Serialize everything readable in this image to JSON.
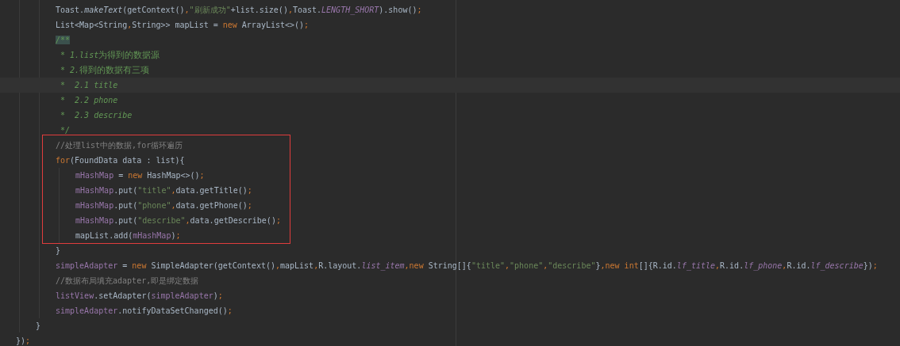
{
  "editor": {
    "code": [
      {
        "kind": "block",
        "children": [
          {
            "kind": "block",
            "children": [
              {
                "kind": "line",
                "tokens": [
                  {
                    "kind": "plain",
                    "text": "Toast."
                  },
                  {
                    "kind": "static-method",
                    "text": "makeText"
                  },
                  {
                    "kind": "plain",
                    "text": "(getContext()"
                  },
                  {
                    "kind": "punct",
                    "text": ","
                  },
                  {
                    "kind": "string",
                    "text": "\"刷新成功\""
                  },
                  {
                    "kind": "plain",
                    "text": "+list.size()"
                  },
                  {
                    "kind": "punct",
                    "text": ","
                  },
                  {
                    "kind": "plain",
                    "text": "Toast."
                  },
                  {
                    "kind": "static",
                    "text": "LENGTH_SHORT"
                  },
                  {
                    "kind": "plain",
                    "text": ").show()"
                  },
                  {
                    "kind": "punct",
                    "text": ";"
                  }
                ]
              },
              {
                "kind": "line",
                "tokens": [
                  {
                    "kind": "plain",
                    "text": "List<Map<String"
                  },
                  {
                    "kind": "punct",
                    "text": ","
                  },
                  {
                    "kind": "plain",
                    "text": "String>> mapList = "
                  },
                  {
                    "kind": "keyword",
                    "text": "new"
                  },
                  {
                    "kind": "plain",
                    "text": " ArrayList<>()"
                  },
                  {
                    "kind": "punct",
                    "text": ";"
                  }
                ]
              },
              {
                "kind": "line",
                "tokens": [
                  {
                    "kind": "doc-match",
                    "text": "/**"
                  }
                ]
              },
              {
                "kind": "line",
                "tokens": [
                  {
                    "kind": "doc-italic",
                    "text": " * 1.list"
                  },
                  {
                    "kind": "doc",
                    "text": "为得到的数据源"
                  }
                ]
              },
              {
                "kind": "line",
                "tokens": [
                  {
                    "kind": "doc-italic",
                    "text": " * 2."
                  },
                  {
                    "kind": "doc",
                    "text": "得到的数据有三项"
                  }
                ]
              },
              {
                "kind": "line",
                "current": true,
                "tokens": [
                  {
                    "kind": "doc-italic",
                    "text": " *  2.1 title"
                  }
                ]
              },
              {
                "kind": "line",
                "tokens": [
                  {
                    "kind": "doc-italic",
                    "text": " *  2.2 phone"
                  }
                ]
              },
              {
                "kind": "line",
                "tokens": [
                  {
                    "kind": "doc-italic",
                    "text": " *  2.3 describe"
                  }
                ]
              },
              {
                "kind": "line",
                "tokens": [
                  {
                    "kind": "doc-italic",
                    "text": " */"
                  }
                ]
              },
              {
                "kind": "marked",
                "items": [
                  {
                    "kind": "line",
                    "tokens": [
                      {
                        "kind": "comment",
                        "text": "//处理list中的数据,for循环遍历"
                      }
                    ]
                  },
                  {
                    "kind": "line",
                    "tokens": [
                      {
                        "kind": "keyword",
                        "text": "for"
                      },
                      {
                        "kind": "plain",
                        "text": "(FoundData data : list){"
                      }
                    ]
                  },
                  {
                    "kind": "block",
                    "children": [
                      {
                        "kind": "line",
                        "tokens": [
                          {
                            "kind": "field",
                            "text": "mHashMap"
                          },
                          {
                            "kind": "plain",
                            "text": " = "
                          },
                          {
                            "kind": "keyword",
                            "text": "new"
                          },
                          {
                            "kind": "plain",
                            "text": " HashMap<>()"
                          },
                          {
                            "kind": "punct",
                            "text": ";"
                          }
                        ]
                      },
                      {
                        "kind": "line",
                        "tokens": [
                          {
                            "kind": "field",
                            "text": "mHashMap"
                          },
                          {
                            "kind": "plain",
                            "text": ".put("
                          },
                          {
                            "kind": "string",
                            "text": "\"title\""
                          },
                          {
                            "kind": "punct",
                            "text": ","
                          },
                          {
                            "kind": "plain",
                            "text": "data.getTitle()"
                          },
                          {
                            "kind": "punct",
                            "text": ";"
                          }
                        ]
                      },
                      {
                        "kind": "line",
                        "tokens": [
                          {
                            "kind": "field",
                            "text": "mHashMap"
                          },
                          {
                            "kind": "plain",
                            "text": ".put("
                          },
                          {
                            "kind": "string",
                            "text": "\"phone\""
                          },
                          {
                            "kind": "punct",
                            "text": ","
                          },
                          {
                            "kind": "plain",
                            "text": "data.getPhone()"
                          },
                          {
                            "kind": "punct",
                            "text": ";"
                          }
                        ]
                      },
                      {
                        "kind": "line",
                        "tokens": [
                          {
                            "kind": "field",
                            "text": "mHashMap"
                          },
                          {
                            "kind": "plain",
                            "text": ".put("
                          },
                          {
                            "kind": "string",
                            "text": "\"describe\""
                          },
                          {
                            "kind": "punct",
                            "text": ","
                          },
                          {
                            "kind": "plain",
                            "text": "data.getDescribe()"
                          },
                          {
                            "kind": "punct",
                            "text": ";"
                          }
                        ]
                      },
                      {
                        "kind": "line",
                        "tokens": [
                          {
                            "kind": "plain",
                            "text": "mapList.add("
                          },
                          {
                            "kind": "field",
                            "text": "mHashMap"
                          },
                          {
                            "kind": "plain",
                            "text": ")"
                          },
                          {
                            "kind": "punct",
                            "text": ";"
                          }
                        ]
                      }
                    ]
                  }
                ]
              },
              {
                "kind": "line",
                "tokens": [
                  {
                    "kind": "plain",
                    "text": "}"
                  }
                ]
              },
              {
                "kind": "line",
                "tokens": [
                  {
                    "kind": "field",
                    "text": "simpleAdapter"
                  },
                  {
                    "kind": "plain",
                    "text": " = "
                  },
                  {
                    "kind": "keyword",
                    "text": "new"
                  },
                  {
                    "kind": "plain",
                    "text": " SimpleAdapter(getContext()"
                  },
                  {
                    "kind": "punct",
                    "text": ","
                  },
                  {
                    "kind": "plain",
                    "text": "mapList"
                  },
                  {
                    "kind": "punct",
                    "text": ","
                  },
                  {
                    "kind": "plain",
                    "text": "R.layout."
                  },
                  {
                    "kind": "static",
                    "text": "list_item"
                  },
                  {
                    "kind": "punct",
                    "text": ","
                  },
                  {
                    "kind": "keyword",
                    "text": "new"
                  },
                  {
                    "kind": "plain",
                    "text": " String[]{"
                  },
                  {
                    "kind": "string",
                    "text": "\"title\""
                  },
                  {
                    "kind": "punct",
                    "text": ","
                  },
                  {
                    "kind": "string",
                    "text": "\"phone\""
                  },
                  {
                    "kind": "punct",
                    "text": ","
                  },
                  {
                    "kind": "string",
                    "text": "\"describe\""
                  },
                  {
                    "kind": "plain",
                    "text": "}"
                  },
                  {
                    "kind": "punct",
                    "text": ","
                  },
                  {
                    "kind": "keyword",
                    "text": "new int"
                  },
                  {
                    "kind": "plain",
                    "text": "[]{R.id."
                  },
                  {
                    "kind": "static",
                    "text": "lf_title"
                  },
                  {
                    "kind": "punct",
                    "text": ","
                  },
                  {
                    "kind": "plain",
                    "text": "R.id."
                  },
                  {
                    "kind": "static",
                    "text": "lf_phone"
                  },
                  {
                    "kind": "punct",
                    "text": ","
                  },
                  {
                    "kind": "plain",
                    "text": "R.id."
                  },
                  {
                    "kind": "static",
                    "text": "lf_describe"
                  },
                  {
                    "kind": "plain",
                    "text": "})"
                  },
                  {
                    "kind": "punct",
                    "text": ";"
                  }
                ]
              },
              {
                "kind": "line",
                "tokens": [
                  {
                    "kind": "comment",
                    "text": "//数据布局填充adapter,即是绑定数据"
                  }
                ]
              },
              {
                "kind": "line",
                "tokens": [
                  {
                    "kind": "field",
                    "text": "listView"
                  },
                  {
                    "kind": "plain",
                    "text": ".setAdapter("
                  },
                  {
                    "kind": "field",
                    "text": "simpleAdapter"
                  },
                  {
                    "kind": "plain",
                    "text": ")"
                  },
                  {
                    "kind": "punct",
                    "text": ";"
                  }
                ]
              },
              {
                "kind": "line",
                "tokens": [
                  {
                    "kind": "field",
                    "text": "simpleAdapter"
                  },
                  {
                    "kind": "plain",
                    "text": ".notifyDataSetChanged()"
                  },
                  {
                    "kind": "punct",
                    "text": ";"
                  }
                ]
              }
            ]
          },
          {
            "kind": "line",
            "tokens": [
              {
                "kind": "plain",
                "text": "}"
              }
            ]
          }
        ]
      },
      {
        "kind": "line",
        "tokens": [
          {
            "kind": "plain",
            "text": "})"
          },
          {
            "kind": "punct",
            "text": ";"
          }
        ]
      }
    ]
  }
}
